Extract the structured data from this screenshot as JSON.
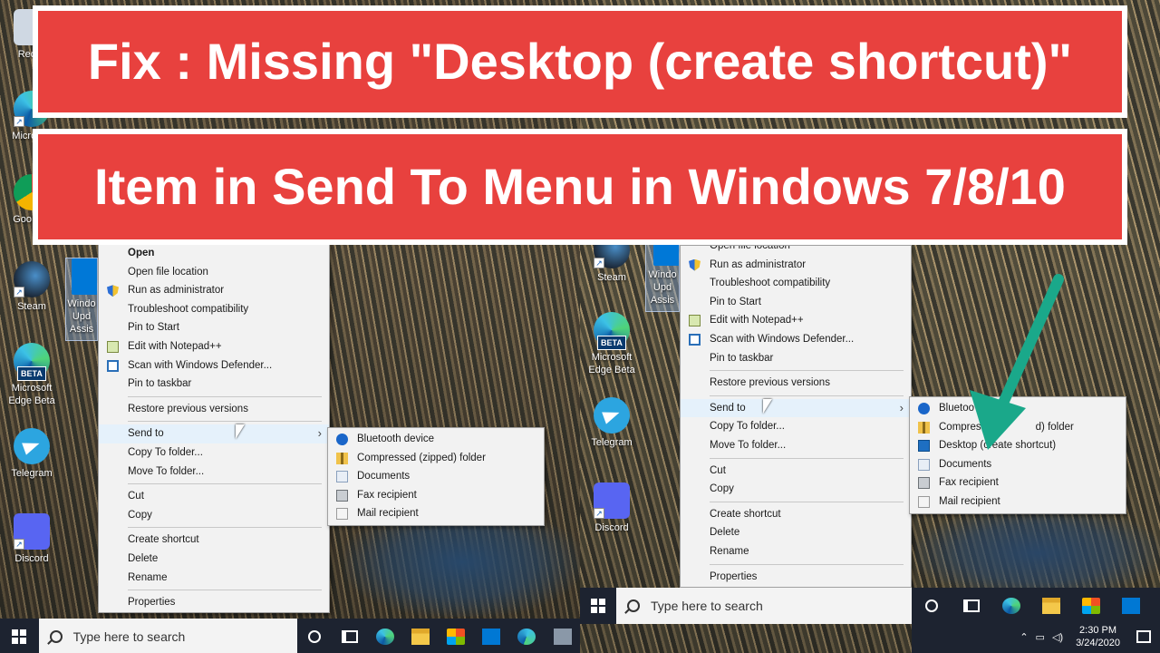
{
  "banner": {
    "line1": "Fix : Missing \"Desktop (create shortcut)\"",
    "line2": "Item in Send To Menu in Windows 7/8/10"
  },
  "left_desktop_icons": [
    {
      "label": "Recyc",
      "icon": "recycle-bin-icon"
    },
    {
      "label": "Micro Ed",
      "icon": "edge-icon"
    },
    {
      "label": "Goo Chr",
      "icon": "chrome-icon"
    },
    {
      "label": "Steam",
      "icon": "steam-icon"
    },
    {
      "label": "Windo Upd Assis",
      "icon": "windows-update-icon"
    },
    {
      "label": "Microsoft Edge Beta",
      "icon": "edge-beta-icon"
    },
    {
      "label": "Telegram",
      "icon": "telegram-icon"
    },
    {
      "label": "Discord",
      "icon": "discord-icon"
    }
  ],
  "right_desktop_icons": [
    {
      "label": "Steam",
      "icon": "steam-icon"
    },
    {
      "label": "Windo Upd Assis",
      "icon": "windows-update-icon"
    },
    {
      "label": "Microsoft Edge Beta",
      "icon": "edge-beta-icon"
    },
    {
      "label": "Telegram",
      "icon": "telegram-icon"
    },
    {
      "label": "Discord",
      "icon": "discord-icon"
    }
  ],
  "beta_badge": "BETA",
  "left_menu": {
    "items": [
      "Open",
      "Open file location",
      "Run as administrator",
      "Troubleshoot compatibility",
      "Pin to Start",
      "Edit with Notepad++",
      "Scan with Windows Defender...",
      "Pin to taskbar",
      "Restore previous versions",
      "Send to",
      "Copy To folder...",
      "Move To folder...",
      "Cut",
      "Copy",
      "Create shortcut",
      "Delete",
      "Rename",
      "Properties"
    ]
  },
  "left_sendto": {
    "items": [
      "Bluetooth device",
      "Compressed (zipped) folder",
      "Documents",
      "Fax recipient",
      "Mail recipient"
    ]
  },
  "right_menu": {
    "items": [
      "Open file location",
      "Run as administrator",
      "Troubleshoot compatibility",
      "Pin to Start",
      "Edit with Notepad++",
      "Scan with Windows Defender...",
      "Pin to taskbar",
      "Restore previous versions",
      "Send to",
      "Copy To folder...",
      "Move To folder...",
      "Cut",
      "Copy",
      "Create shortcut",
      "Delete",
      "Rename",
      "Properties"
    ]
  },
  "right_sendto": {
    "items": [
      "Bluetooth device",
      "Compressed (zipped) folder",
      "Desktop (create shortcut)",
      "Documents",
      "Fax recipient",
      "Mail recipient"
    ],
    "visible_text": [
      "Bluetoo",
      "Compres",
      "d) folder",
      "Desktop (create shortcut)",
      "Documents",
      "Fax recipient",
      "Mail recipient"
    ]
  },
  "submenu_arrow": "›",
  "taskbar": {
    "search_placeholder": "Type here to search",
    "clock_time": "2:30 PM",
    "clock_date": "3/24/2020"
  },
  "colors": {
    "banner_red": "#e8413e",
    "annotation_arrow": "#1aa88a",
    "taskbar": "#1d2330",
    "menu_bg": "#f2f2f2"
  }
}
